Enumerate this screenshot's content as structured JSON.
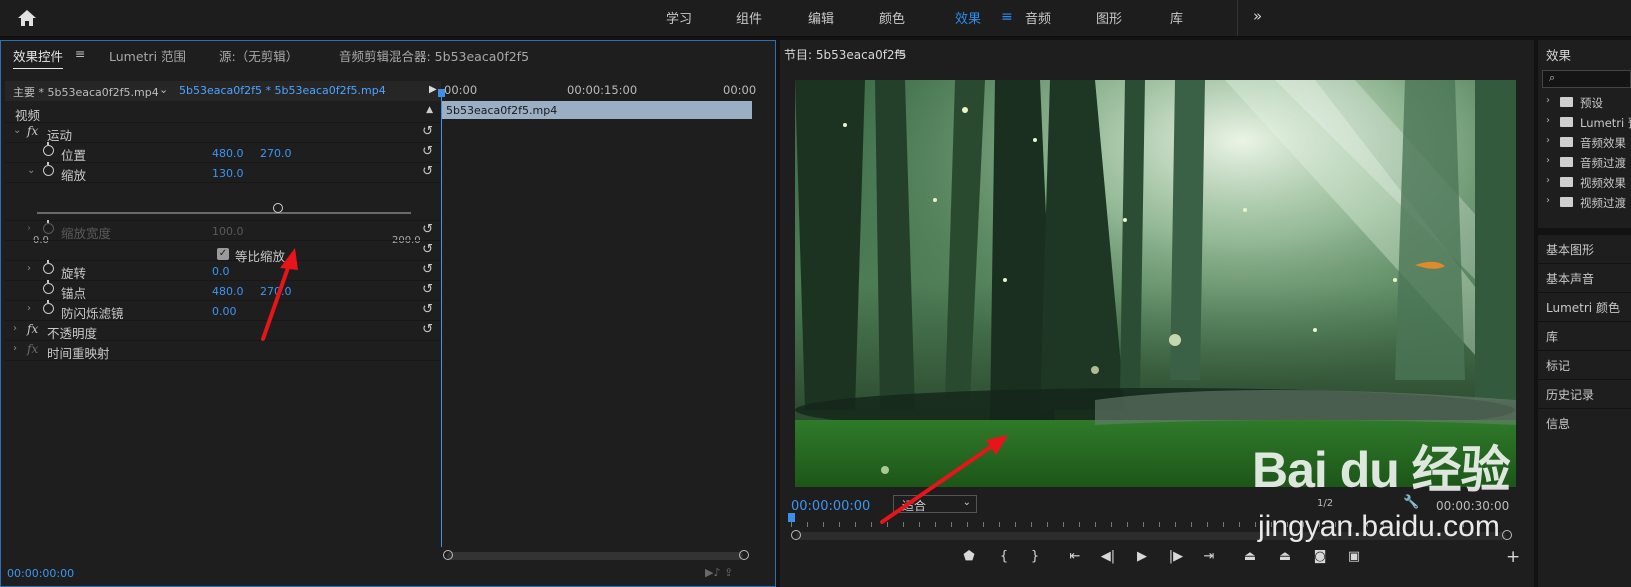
{
  "topbar": {
    "workspaces": [
      "学习",
      "组件",
      "编辑",
      "颜色",
      "效果",
      "音频",
      "图形",
      "库"
    ],
    "active": "效果",
    "more": "»"
  },
  "left_panel": {
    "tabs": {
      "effect_controls": "效果控件",
      "lumetri_scopes": "Lumetri 范围",
      "source": "源:（无剪辑）",
      "audio_mixer": "音频剪辑混合器: 5b53eaca0f2f5"
    },
    "menu_glyph": "≡",
    "clip_main": "主要 * 5b53eaca0f2f5.mp4",
    "clip_sequence": "5b53eaca0f2f5 * 5b53eaca0f2f5.mp4",
    "section_video": "视频",
    "rows": {
      "motion": "运动",
      "position": "位置",
      "position_x": "480.0",
      "position_y": "270.0",
      "scale": "缩放",
      "scale_value": "130.0",
      "slider_min": "0.0",
      "slider_max": "200.0",
      "scale_width": "缩放宽度",
      "scale_width_value": "100.0",
      "uniform_scale": "等比缩放",
      "rotation": "旋转",
      "rotation_value": "0.0",
      "anchor": "锚点",
      "anchor_x": "480.0",
      "anchor_y": "270.0",
      "flicker": "防闪烁滤镜",
      "flicker_value": "0.00",
      "opacity": "不透明度",
      "time_remap": "时间重映射"
    },
    "timeline": {
      "t0": "00:00",
      "t15": "00:00:15:00",
      "tend": "00:00",
      "clip_name": "5b53eaca0f2f5.mp4"
    },
    "timecode": "00:00:00:00"
  },
  "program": {
    "title": "节目: 5b53eaca0f2f5",
    "menu_glyph": "≡",
    "timecode": "00:00:00:00",
    "fit": "适合",
    "resolution": "1/2",
    "duration": "00:00:30:00"
  },
  "right_panel": {
    "title": "效果",
    "folders": [
      "预设",
      "Lumetri 预设",
      "音频效果",
      "音频过渡",
      "视频效果",
      "视频过渡"
    ],
    "items": [
      "基本图形",
      "基本声音",
      "Lumetri 颜色",
      "库",
      "标记",
      "历史记录",
      "信息"
    ]
  },
  "watermark": {
    "brand": "Bai du 经验",
    "url": "jingyan.baidu.com"
  },
  "colors": {
    "accent": "#2d8ceb",
    "panel_bg": "#1e1e1e",
    "app_bg": "#121212",
    "annotation": "#e8141a"
  }
}
